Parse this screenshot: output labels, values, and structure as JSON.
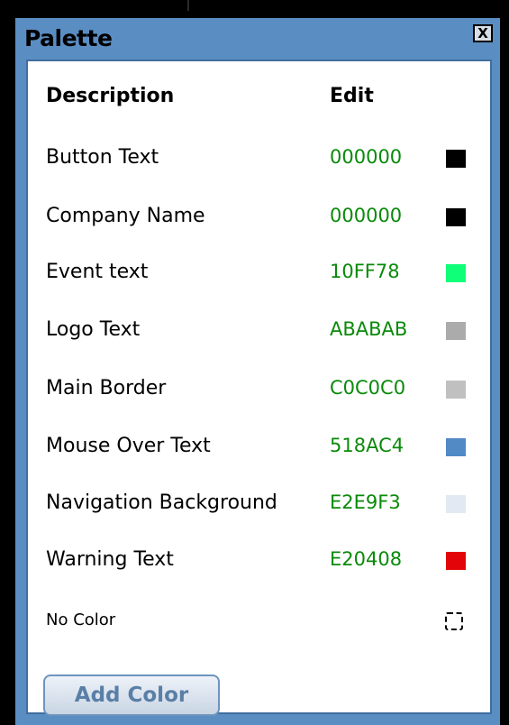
{
  "window": {
    "title": "Palette",
    "close_label": "X"
  },
  "columns": {
    "description": "Description",
    "edit": "Edit"
  },
  "rows": [
    {
      "label": "Button Text",
      "hex": "000000",
      "color": "#000000"
    },
    {
      "label": "Company Name",
      "hex": "000000",
      "color": "#000000"
    },
    {
      "label": "Event text",
      "hex": "10FF78",
      "color": "#10FF78"
    },
    {
      "label": "Logo Text",
      "hex": "ABABAB",
      "color": "#ABABAB"
    },
    {
      "label": "Main Border",
      "hex": "C0C0C0",
      "color": "#C0C0C0"
    },
    {
      "label": "Mouse Over Text",
      "hex": "518AC4",
      "color": "#518AC4"
    },
    {
      "label": "Navigation Background",
      "hex": "E2E9F3",
      "color": "#E2E9F3"
    },
    {
      "label": "Warning Text",
      "hex": "E20408",
      "color": "#E20408"
    }
  ],
  "no_color": {
    "label": "No Color"
  },
  "add_button": {
    "label": "Add Color"
  }
}
